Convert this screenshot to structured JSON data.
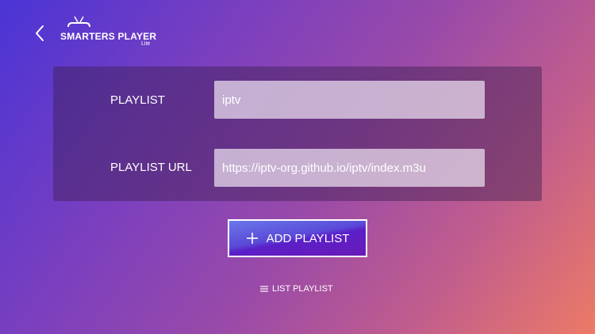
{
  "header": {
    "back_icon": "chevron-left-icon",
    "logo_title": "SMARTERS PLAYER",
    "logo_subtitle": "Lite",
    "logo_icon": "tv-icon"
  },
  "form": {
    "playlist_label": "PLAYLIST",
    "playlist_value": "iptv",
    "url_label": "PLAYLIST URL",
    "url_value": "https://iptv-org.github.io/iptv/index.m3u"
  },
  "actions": {
    "add_icon": "plus-icon",
    "add_label": "ADD PLAYLIST",
    "list_icon": "list-icon",
    "list_label": "LIST PLAYLIST"
  },
  "colors": {
    "background_start": "#4a34d6",
    "background_end": "#ec7a66",
    "button_accent": "#5a1fc8"
  }
}
